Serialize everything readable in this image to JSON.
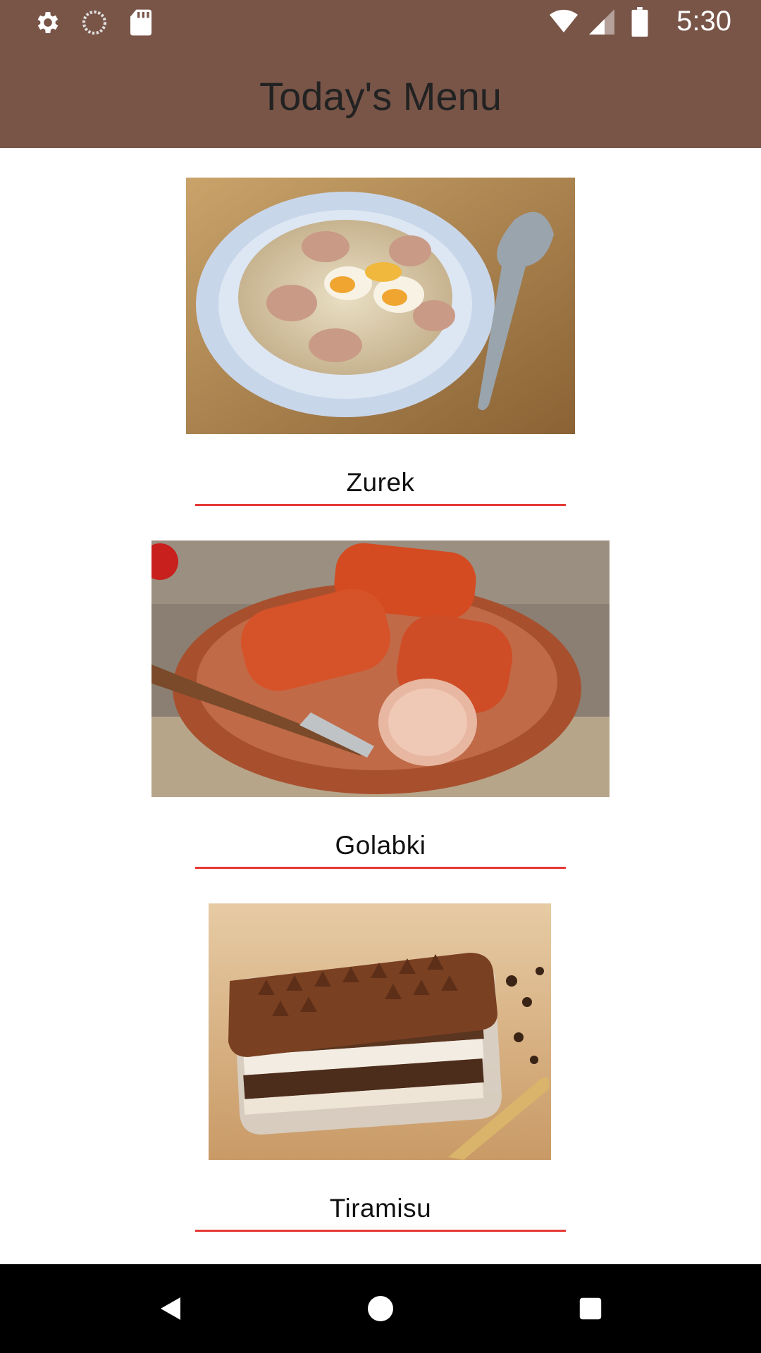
{
  "status_bar": {
    "time": "5:30",
    "icons_left": [
      "gear-icon",
      "sync-icon",
      "sd-card-icon"
    ],
    "icons_right": [
      "wifi-icon",
      "signal-icon",
      "battery-icon"
    ]
  },
  "app_bar": {
    "title": "Today's Menu",
    "background": "#795548"
  },
  "menu": {
    "items": [
      {
        "name": "Zurek",
        "image": "zurek-soup-photo"
      },
      {
        "name": "Golabki",
        "image": "golabki-cabbage-rolls-photo"
      },
      {
        "name": "Tiramisu",
        "image": "tiramisu-dessert-photo"
      }
    ],
    "underline_color": "#e53935"
  },
  "nav_bar": {
    "buttons": [
      "back-icon",
      "home-icon",
      "recents-icon"
    ]
  }
}
